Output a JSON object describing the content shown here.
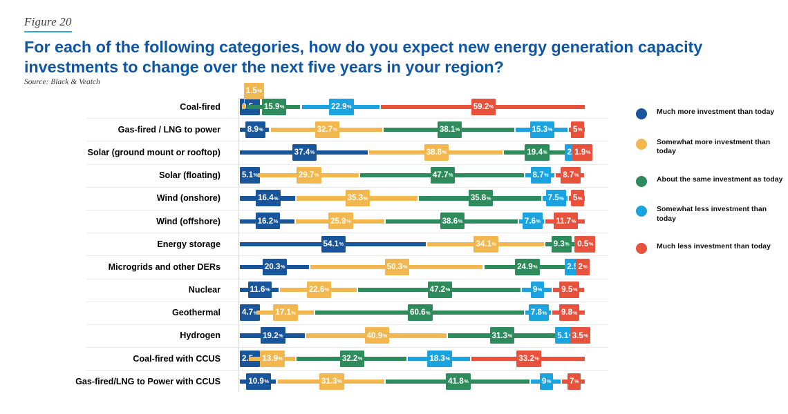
{
  "figure": {
    "label": "Figure 20"
  },
  "header": {
    "title": "For each of the following categories, how do you expect new energy generation capacity investments to change over the next five years in your region?",
    "source": "Source: Black & Veatch"
  },
  "legend": {
    "items": [
      {
        "name": "much-more",
        "label": "Much more investment than today",
        "color": "#18559A"
      },
      {
        "name": "somewhat-more",
        "label": "Somewhat more investment than today",
        "color": "#F2B74E"
      },
      {
        "name": "about-same",
        "label": "About the same investment as today",
        "color": "#2E8B5B"
      },
      {
        "name": "somewhat-less",
        "label": "Somewhat less investment than today",
        "color": "#1BA3E0"
      },
      {
        "name": "much-less",
        "label": "Much less investment than today",
        "color": "#E8523C"
      }
    ]
  },
  "chart_data": {
    "type": "bar",
    "subtype": "stacked-horizontal-100",
    "title": "For each of the following categories, how do you expect new energy generation capacity investments to change over the next five years in your region?",
    "source": "Source: Black & Veatch",
    "xlabel": "",
    "ylabel": "",
    "xlim": [
      0,
      100
    ],
    "grid": false,
    "legend_position": "right",
    "series": [
      {
        "name": "Much more investment than today",
        "color": "#18559A",
        "values": [
          0.5,
          8.9,
          37.4,
          5.1,
          16.4,
          16.2,
          54.1,
          20.3,
          11.6,
          4.7,
          19.2,
          2.5,
          10.9
        ]
      },
      {
        "name": "Somewhat more investment than today",
        "color": "#F2B74E",
        "values": [
          1.5,
          32.7,
          38.8,
          29.7,
          35.3,
          25.9,
          34.1,
          50.3,
          22.6,
          17.1,
          40.9,
          13.9,
          31.3
        ]
      },
      {
        "name": "About the same investment as today",
        "color": "#2E8B5B",
        "values": [
          15.9,
          38.1,
          19.4,
          47.7,
          35.8,
          38.6,
          9.3,
          24.9,
          47.2,
          60.6,
          31.3,
          32.2,
          41.8
        ]
      },
      {
        "name": "Somewhat less investment than today",
        "color": "#1BA3E0",
        "values": [
          22.9,
          15.3,
          2.4,
          8.7,
          7.5,
          7.6,
          2,
          2.5,
          9,
          7.8,
          5.1,
          18.3,
          9
        ]
      },
      {
        "name": "Much less investment than today",
        "color": "#E8523C",
        "values": [
          59.2,
          5,
          1.9,
          8.7,
          5,
          11.7,
          0.5,
          2,
          9.5,
          9.8,
          3.5,
          33.2,
          7
        ]
      }
    ],
    "categories": [
      "Coal-fired",
      "Gas-fired / LNG to power",
      "Solar (ground mount or rooftop)",
      "Solar (floating)",
      "Wind (onshore)",
      "Wind (offshore)",
      "Energy storage",
      "Microgrids and other DERs",
      "Nuclear",
      "Geothermal",
      "Hydrogen",
      "Coal-fired with CCUS",
      "Gas-fired/LNG to Power with CCUS"
    ],
    "rows": [
      {
        "category": "Coal-fired",
        "segments": [
          {
            "series": "much-more",
            "value": 0.5,
            "label": "0.5",
            "color": "#18559A"
          },
          {
            "series": "somewhat-more",
            "value": 1.5,
            "label": "1.5",
            "color": "#F2B74E",
            "callout": true
          },
          {
            "series": "about-same",
            "value": 15.9,
            "label": "15.9",
            "color": "#2E8B5B"
          },
          {
            "series": "somewhat-less",
            "value": 22.9,
            "label": "22.9",
            "color": "#1BA3E0"
          },
          {
            "series": "much-less",
            "value": 59.2,
            "label": "59.2",
            "color": "#E8523C"
          }
        ]
      },
      {
        "category": "Gas-fired / LNG to power",
        "segments": [
          {
            "series": "much-more",
            "value": 8.9,
            "label": "8.9",
            "color": "#18559A"
          },
          {
            "series": "somewhat-more",
            "value": 32.7,
            "label": "32.7",
            "color": "#F2B74E"
          },
          {
            "series": "about-same",
            "value": 38.1,
            "label": "38.1",
            "color": "#2E8B5B"
          },
          {
            "series": "somewhat-less",
            "value": 15.3,
            "label": "15.3",
            "color": "#1BA3E0"
          },
          {
            "series": "much-less",
            "value": 5,
            "label": "5",
            "color": "#E8523C"
          }
        ]
      },
      {
        "category": "Solar (ground mount or rooftop)",
        "segments": [
          {
            "series": "much-more",
            "value": 37.4,
            "label": "37.4",
            "color": "#18559A"
          },
          {
            "series": "somewhat-more",
            "value": 38.8,
            "label": "38.8",
            "color": "#F2B74E"
          },
          {
            "series": "about-same",
            "value": 19.4,
            "label": "19.4",
            "color": "#2E8B5B"
          },
          {
            "series": "somewhat-less",
            "value": 2.4,
            "label": "2.4",
            "color": "#1BA3E0"
          },
          {
            "series": "much-less",
            "value": 1.9,
            "label": "1.9",
            "color": "#E8523C"
          }
        ]
      },
      {
        "category": "Solar (floating)",
        "segments": [
          {
            "series": "much-more",
            "value": 5.1,
            "label": "5.1",
            "color": "#18559A"
          },
          {
            "series": "somewhat-more",
            "value": 29.7,
            "label": "29.7",
            "color": "#F2B74E"
          },
          {
            "series": "about-same",
            "value": 47.7,
            "label": "47.7",
            "color": "#2E8B5B"
          },
          {
            "series": "somewhat-less",
            "value": 8.7,
            "label": "8.7",
            "color": "#1BA3E0"
          },
          {
            "series": "much-less",
            "value": 8.7,
            "label": "8.7",
            "color": "#E8523C"
          }
        ]
      },
      {
        "category": "Wind (onshore)",
        "segments": [
          {
            "series": "much-more",
            "value": 16.4,
            "label": "16.4",
            "color": "#18559A"
          },
          {
            "series": "somewhat-more",
            "value": 35.3,
            "label": "35.3",
            "color": "#F2B74E"
          },
          {
            "series": "about-same",
            "value": 35.8,
            "label": "35.8",
            "color": "#2E8B5B"
          },
          {
            "series": "somewhat-less",
            "value": 7.5,
            "label": "7.5",
            "color": "#1BA3E0"
          },
          {
            "series": "much-less",
            "value": 5,
            "label": "5",
            "color": "#E8523C"
          }
        ]
      },
      {
        "category": "Wind (offshore)",
        "segments": [
          {
            "series": "much-more",
            "value": 16.2,
            "label": "16.2",
            "color": "#18559A"
          },
          {
            "series": "somewhat-more",
            "value": 25.9,
            "label": "25.9",
            "color": "#F2B74E"
          },
          {
            "series": "about-same",
            "value": 38.6,
            "label": "38.6",
            "color": "#2E8B5B"
          },
          {
            "series": "somewhat-less",
            "value": 7.6,
            "label": "7.6",
            "color": "#1BA3E0"
          },
          {
            "series": "much-less",
            "value": 11.7,
            "label": "11.7",
            "color": "#E8523C"
          }
        ]
      },
      {
        "category": "Energy storage",
        "segments": [
          {
            "series": "much-more",
            "value": 54.1,
            "label": "54.1",
            "color": "#18559A"
          },
          {
            "series": "somewhat-more",
            "value": 34.1,
            "label": "34.1",
            "color": "#F2B74E"
          },
          {
            "series": "about-same",
            "value": 9.3,
            "label": "9.3",
            "color": "#2E8B5B"
          },
          {
            "series": "somewhat-less",
            "value": 2,
            "label": "2",
            "color": "#1BA3E0"
          },
          {
            "series": "much-less",
            "value": 0.5,
            "label": "0.5",
            "color": "#E8523C"
          }
        ]
      },
      {
        "category": "Microgrids and other DERs",
        "segments": [
          {
            "series": "much-more",
            "value": 20.3,
            "label": "20.3",
            "color": "#18559A"
          },
          {
            "series": "somewhat-more",
            "value": 50.3,
            "label": "50.3",
            "color": "#F2B74E"
          },
          {
            "series": "about-same",
            "value": 24.9,
            "label": "24.9",
            "color": "#2E8B5B"
          },
          {
            "series": "somewhat-less",
            "value": 2.5,
            "label": "2.5",
            "color": "#1BA3E0"
          },
          {
            "series": "much-less",
            "value": 2,
            "label": "2",
            "color": "#E8523C"
          }
        ]
      },
      {
        "category": "Nuclear",
        "segments": [
          {
            "series": "much-more",
            "value": 11.6,
            "label": "11.6",
            "color": "#18559A"
          },
          {
            "series": "somewhat-more",
            "value": 22.6,
            "label": "22.6",
            "color": "#F2B74E"
          },
          {
            "series": "about-same",
            "value": 47.2,
            "label": "47.2",
            "color": "#2E8B5B"
          },
          {
            "series": "somewhat-less",
            "value": 9,
            "label": "9",
            "color": "#1BA3E0"
          },
          {
            "series": "much-less",
            "value": 9.5,
            "label": "9.5",
            "color": "#E8523C"
          }
        ]
      },
      {
        "category": "Geothermal",
        "segments": [
          {
            "series": "much-more",
            "value": 4.7,
            "label": "4.7",
            "color": "#18559A"
          },
          {
            "series": "somewhat-more",
            "value": 17.1,
            "label": "17.1",
            "color": "#F2B74E"
          },
          {
            "series": "about-same",
            "value": 60.6,
            "label": "60.6",
            "color": "#2E8B5B"
          },
          {
            "series": "somewhat-less",
            "value": 7.8,
            "label": "7.8",
            "color": "#1BA3E0"
          },
          {
            "series": "much-less",
            "value": 9.8,
            "label": "9.8",
            "color": "#E8523C"
          }
        ]
      },
      {
        "category": "Hydrogen",
        "segments": [
          {
            "series": "much-more",
            "value": 19.2,
            "label": "19.2",
            "color": "#18559A"
          },
          {
            "series": "somewhat-more",
            "value": 40.9,
            "label": "40.9",
            "color": "#F2B74E"
          },
          {
            "series": "about-same",
            "value": 31.3,
            "label": "31.3",
            "color": "#2E8B5B"
          },
          {
            "series": "somewhat-less",
            "value": 5.1,
            "label": "5.1",
            "color": "#1BA3E0"
          },
          {
            "series": "much-less",
            "value": 3.5,
            "label": "3.5",
            "color": "#E8523C"
          }
        ]
      },
      {
        "category": "Coal-fired with CCUS",
        "segments": [
          {
            "series": "much-more",
            "value": 2.5,
            "label": "2.5",
            "color": "#18559A"
          },
          {
            "series": "somewhat-more",
            "value": 13.9,
            "label": "13.9",
            "color": "#F2B74E"
          },
          {
            "series": "about-same",
            "value": 32.2,
            "label": "32.2",
            "color": "#2E8B5B"
          },
          {
            "series": "somewhat-less",
            "value": 18.3,
            "label": "18.3",
            "color": "#1BA3E0"
          },
          {
            "series": "much-less",
            "value": 33.2,
            "label": "33.2",
            "color": "#E8523C"
          }
        ]
      },
      {
        "category": "Gas-fired/LNG to Power with CCUS",
        "segments": [
          {
            "series": "much-more",
            "value": 10.9,
            "label": "10.9",
            "color": "#18559A"
          },
          {
            "series": "somewhat-more",
            "value": 31.3,
            "label": "31.3",
            "color": "#F2B74E"
          },
          {
            "series": "about-same",
            "value": 41.8,
            "label": "41.8",
            "color": "#2E8B5B"
          },
          {
            "series": "somewhat-less",
            "value": 9,
            "label": "9",
            "color": "#1BA3E0"
          },
          {
            "series": "much-less",
            "value": 7,
            "label": "7",
            "color": "#E8523C"
          }
        ]
      }
    ]
  }
}
